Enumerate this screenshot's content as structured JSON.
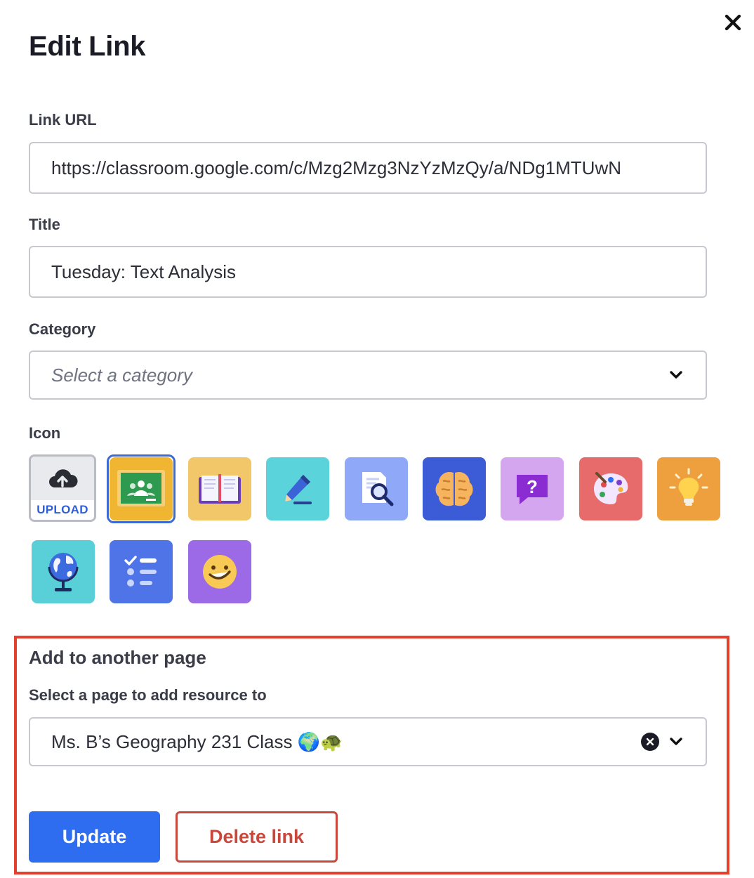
{
  "dialog": {
    "title": "Edit Link"
  },
  "link_url": {
    "label": "Link URL",
    "value": "https://classroom.google.com/c/Mzg2Mzg3NzYzMzQy/a/NDg1MTUwN"
  },
  "title_field": {
    "label": "Title",
    "value": "Tuesday: Text Analysis"
  },
  "category": {
    "label": "Category",
    "placeholder": "Select a category"
  },
  "icon_picker": {
    "label": "Icon",
    "upload_label": "UPLOAD",
    "selected": "google-classroom-icon",
    "icons": [
      "google-classroom-icon",
      "open-book-icon",
      "pencil-icon",
      "magnifier-document-icon",
      "brain-icon",
      "question-bubble-icon",
      "paint-palette-icon",
      "lightbulb-icon",
      "globe-icon",
      "checklist-icon",
      "smiley-face-icon"
    ],
    "colors": [
      "#f0b531",
      "#f1c76a",
      "#5bd3da",
      "#8fa8f7",
      "#3c5bd6",
      "#d4a6ef",
      "#e86b6b",
      "#ee9f3e",
      "#59cfd8",
      "#4f74e8",
      "#9c6ae6"
    ]
  },
  "add_to_page": {
    "title": "Add to another page",
    "label": "Select a page to add resource to",
    "value": "Ms. B’s Geography 231 Class 🌍🐢"
  },
  "actions": {
    "update": "Update",
    "delete": "Delete link"
  },
  "colors": {
    "primary": "#2f6df0",
    "danger": "#c9483c",
    "highlight": "#e3402d"
  }
}
